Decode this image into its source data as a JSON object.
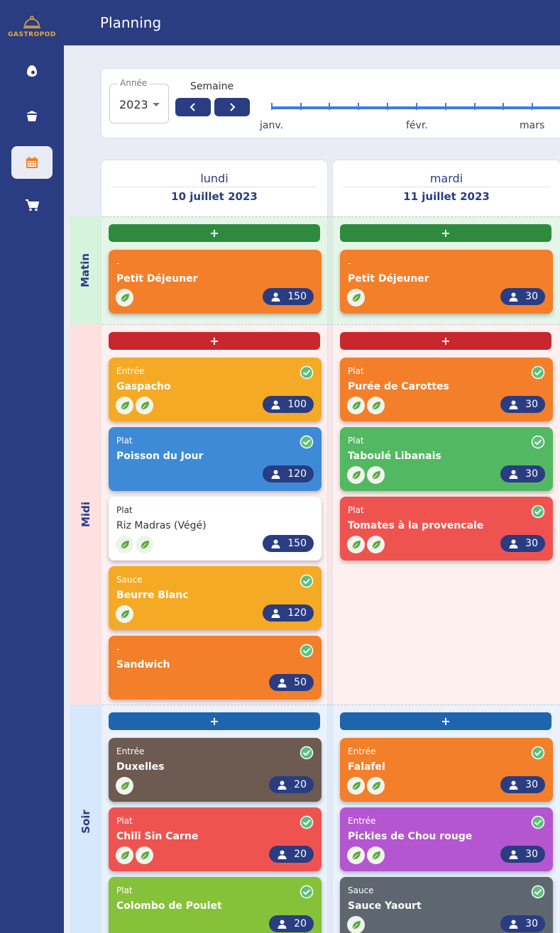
{
  "app": {
    "logo_text": "GASTROPOD",
    "page_title": "Planning"
  },
  "sidebar": {
    "items": [
      {
        "icon": "egg-icon",
        "active": false
      },
      {
        "icon": "cake-icon",
        "active": false
      },
      {
        "icon": "calendar-icon",
        "active": true
      },
      {
        "icon": "cart-icon",
        "active": false
      }
    ]
  },
  "filters": {
    "year_label": "Année",
    "year_value": "2023",
    "week_label": "Semaine",
    "months": [
      "janv.",
      "févr.",
      "mars"
    ]
  },
  "colors": {
    "primary": "#2a3c82",
    "matin_add": "#2e8b3e",
    "midi_add": "#c9272e",
    "soir_add": "#1f65ad"
  },
  "meals": {
    "matin": "Matin",
    "midi": "Midi",
    "soir": "Soir"
  },
  "add_label": "+",
  "days": [
    {
      "name": "lundi",
      "date": "10 juillet 2023",
      "matin": [
        {
          "cat": "-",
          "name": "Petit Déjeuner",
          "count": "150",
          "color": "#f37f2a",
          "leaves": 1,
          "checked": false
        }
      ],
      "midi": [
        {
          "cat": "Entrée",
          "name": "Gaspacho",
          "count": "100",
          "color": "#f5aa26",
          "leaves": 2,
          "checked": true
        },
        {
          "cat": "Plat",
          "name": "Poisson du Jour",
          "count": "120",
          "color": "#3e8ad7",
          "leaves": 0,
          "checked": true
        },
        {
          "cat": "Plat",
          "name": "Riz Madras (Végé)",
          "count": "150",
          "color": "#ffffff",
          "leaves": 2,
          "checked": false
        },
        {
          "cat": "Sauce",
          "name": "Beurre Blanc",
          "count": "120",
          "color": "#f5aa26",
          "leaves": 1,
          "checked": true
        },
        {
          "cat": "-",
          "name": "Sandwich",
          "count": "50",
          "color": "#f37f2a",
          "leaves": 0,
          "checked": true
        }
      ],
      "soir": [
        {
          "cat": "Entrée",
          "name": "Duxelles",
          "count": "20",
          "color": "#6d5a50",
          "leaves": 1,
          "checked": true
        },
        {
          "cat": "Plat",
          "name": "Chili Sin Carne",
          "count": "20",
          "color": "#ef5350",
          "leaves": 2,
          "checked": true
        },
        {
          "cat": "Plat",
          "name": "Colombo de Poulet",
          "count": "20",
          "color": "#86c13a",
          "leaves": 0,
          "checked": true
        }
      ]
    },
    {
      "name": "mardi",
      "date": "11 juillet 2023",
      "matin": [
        {
          "cat": "-",
          "name": "Petit Déjeuner",
          "count": "30",
          "color": "#f37f2a",
          "leaves": 1,
          "checked": false
        }
      ],
      "midi": [
        {
          "cat": "Plat",
          "name": "Purée de Carottes",
          "count": "30",
          "color": "#f37f2a",
          "leaves": 2,
          "checked": true
        },
        {
          "cat": "Plat",
          "name": "Taboulé Libanais",
          "count": "30",
          "color": "#52b862",
          "leaves": 2,
          "checked": true
        },
        {
          "cat": "Plat",
          "name": "Tomates à la provencale",
          "count": "30",
          "color": "#ef5350",
          "leaves": 2,
          "checked": true
        }
      ],
      "soir": [
        {
          "cat": "Entrée",
          "name": "Falafel",
          "count": "30",
          "color": "#f37f2a",
          "leaves": 2,
          "checked": true
        },
        {
          "cat": "Entrée",
          "name": "Pickles de Chou rouge",
          "count": "30",
          "color": "#b456d0",
          "leaves": 2,
          "checked": true
        },
        {
          "cat": "Sauce",
          "name": "Sauce Yaourt",
          "count": "30",
          "color": "#5e6770",
          "leaves": 1,
          "checked": true
        }
      ]
    }
  ]
}
